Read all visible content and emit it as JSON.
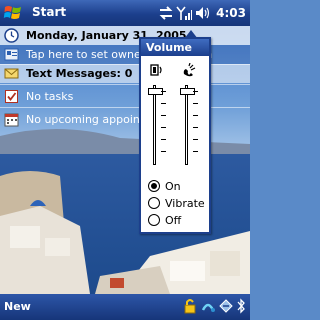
{
  "titlebar": {
    "start_label": "Start",
    "time": "4:03",
    "icons": [
      "windows-flag-icon",
      "connectivity-icon",
      "signal-icon",
      "speaker-icon"
    ]
  },
  "today": {
    "date": "Monday, January 31, 2005",
    "owner_info": "Tap here to set owner information",
    "messages": "Text Messages: 0",
    "tasks": "No tasks",
    "calendar": "No upcoming appointments"
  },
  "volume_popup": {
    "title": "Volume",
    "system_volume_level": 0.92,
    "ringer_volume_level": 0.92,
    "ringer_options": [
      {
        "label": "On",
        "selected": true
      },
      {
        "label": "Vibrate",
        "selected": false
      },
      {
        "label": "Off",
        "selected": false
      }
    ]
  },
  "softkeys": {
    "left": "New"
  },
  "colors": {
    "titlebar_blue": "#1c3f8c",
    "softkey_blue": "#2d56a8"
  }
}
